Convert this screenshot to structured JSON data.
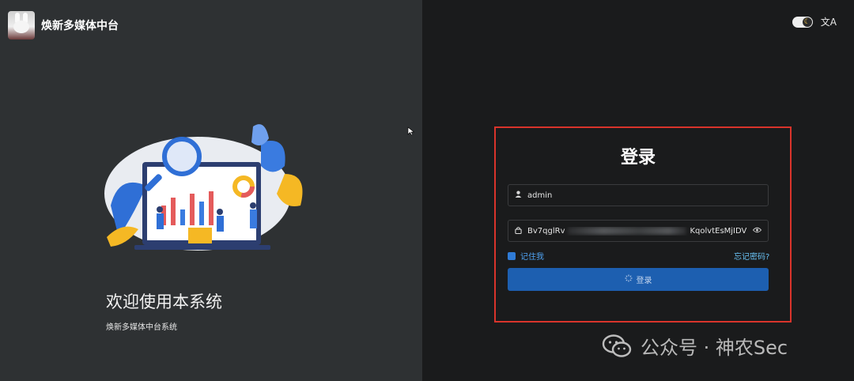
{
  "header": {
    "app_title": "焕新多媒体中台"
  },
  "welcome": {
    "title": "欢迎使用本系统",
    "subtitle": "焕新多媒体中台系统"
  },
  "top_controls": {
    "theme_icon": "moon-icon",
    "language_icon": "translate-icon",
    "language_glyph": "文A"
  },
  "login": {
    "title": "登录",
    "username_value": "admin",
    "password_prefix": "Bv7qglRv",
    "password_suffix": "KqolvtEsMjIDV",
    "remember_label": "记住我",
    "remember_checked": true,
    "forgot_label": "忘记密码?",
    "submit_label": "登录"
  },
  "watermark": {
    "text": "公众号 · 神农Sec"
  },
  "colors": {
    "accent": "#1d5fb0",
    "highlight_border": "#d9342b",
    "link": "#68c0f2"
  }
}
